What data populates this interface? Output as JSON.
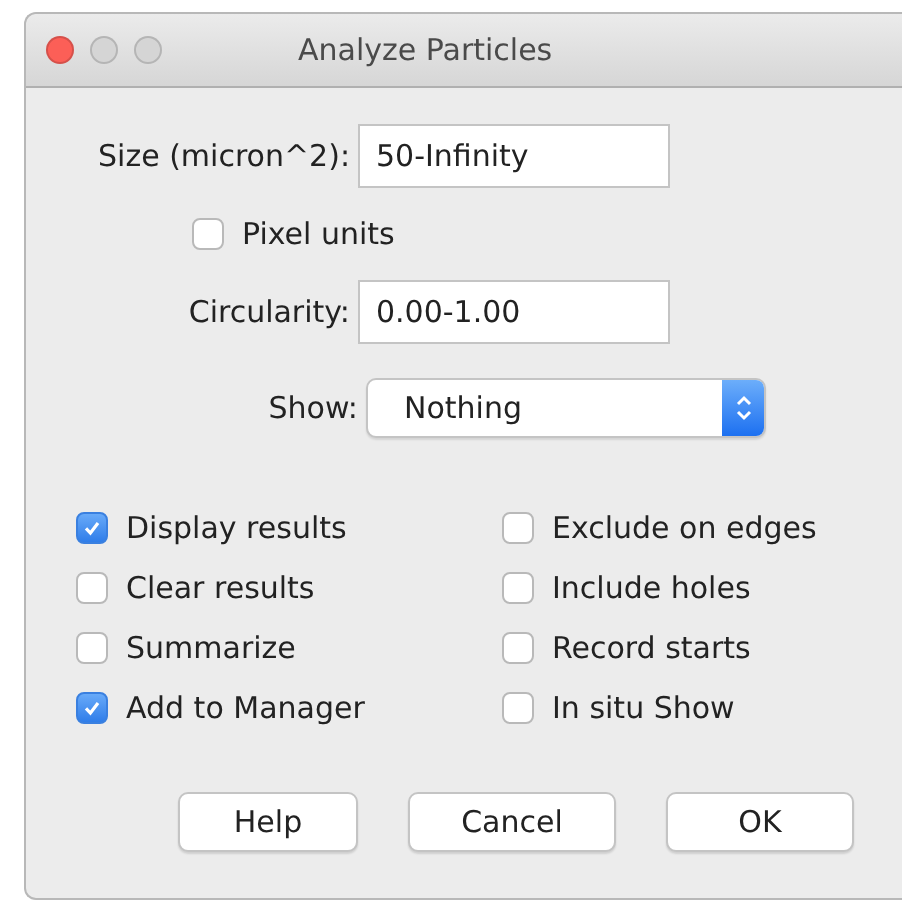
{
  "window": {
    "title": "Analyze Particles"
  },
  "size": {
    "label": "Size (micron^2):",
    "value": "50-Infinity"
  },
  "pixel_units": {
    "label": "Pixel units",
    "checked": false
  },
  "circularity": {
    "label": "Circularity:",
    "value": "0.00-1.00"
  },
  "show": {
    "label": "Show:",
    "value": "Nothing"
  },
  "options": [
    {
      "label": "Display results",
      "checked": true
    },
    {
      "label": "Exclude on edges",
      "checked": false
    },
    {
      "label": "Clear results",
      "checked": false
    },
    {
      "label": "Include holes",
      "checked": false
    },
    {
      "label": "Summarize",
      "checked": false
    },
    {
      "label": "Record starts",
      "checked": false
    },
    {
      "label": "Add to Manager",
      "checked": true
    },
    {
      "label": "In situ Show",
      "checked": false
    }
  ],
  "buttons": [
    "Help",
    "Cancel",
    "OK"
  ]
}
